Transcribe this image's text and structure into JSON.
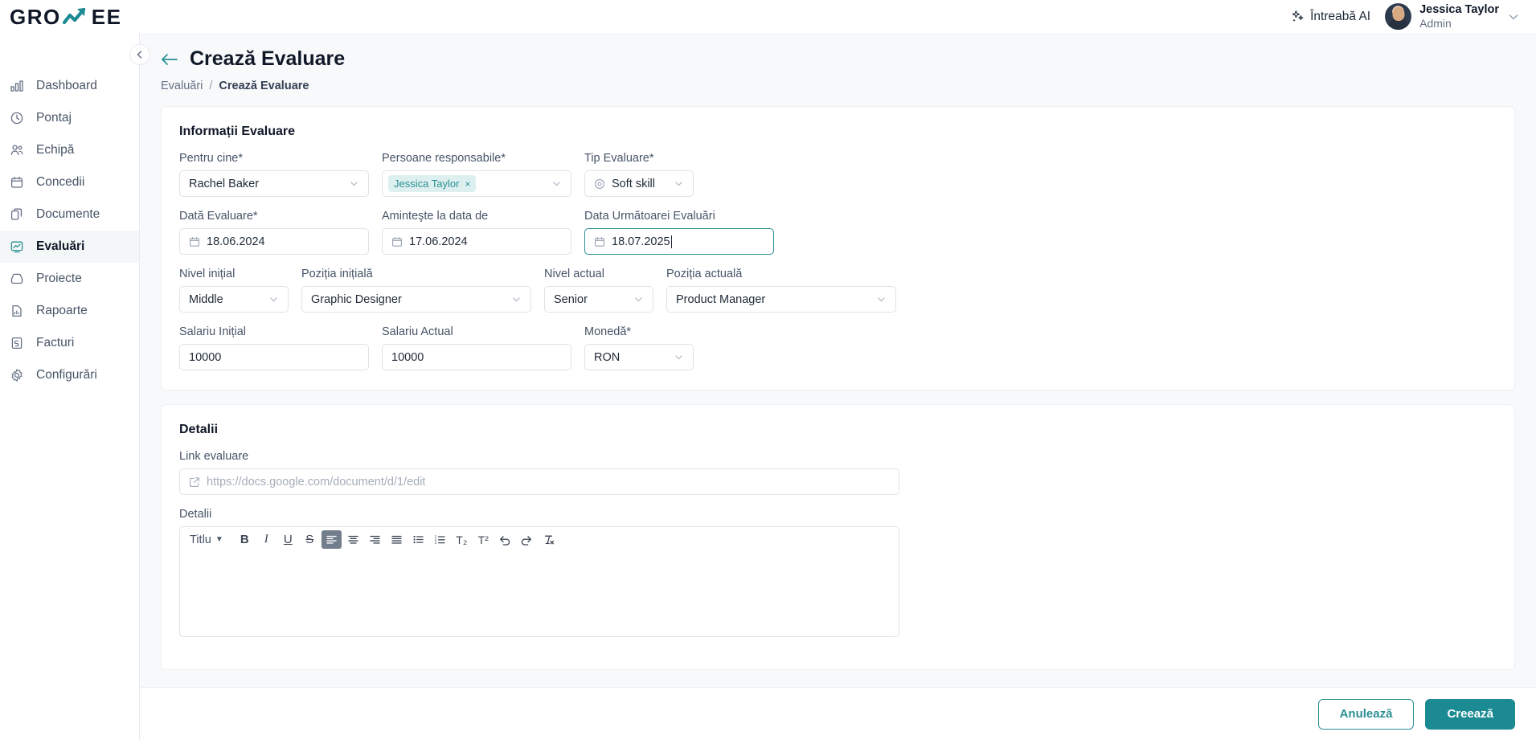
{
  "brand": {
    "name_part1": "GRO",
    "name_part2": "EE",
    "accent": "#1b8a92"
  },
  "topbar": {
    "ask_ai_label": "Întreabă AI",
    "user_name": "Jessica Taylor",
    "user_role": "Admin"
  },
  "sidebar": {
    "items": [
      {
        "label": "Dashboard",
        "icon": "bar-chart-icon",
        "active": false
      },
      {
        "label": "Pontaj",
        "icon": "clock-icon",
        "active": false
      },
      {
        "label": "Echipă",
        "icon": "users-icon",
        "active": false
      },
      {
        "label": "Concedii",
        "icon": "calendar-icon",
        "active": false
      },
      {
        "label": "Documente",
        "icon": "documents-icon",
        "active": false
      },
      {
        "label": "Evaluări",
        "icon": "evaluation-icon",
        "active": true
      },
      {
        "label": "Proiecte",
        "icon": "inbox-icon",
        "active": false
      },
      {
        "label": "Rapoarte",
        "icon": "report-icon",
        "active": false
      },
      {
        "label": "Facturi",
        "icon": "invoice-icon",
        "active": false
      },
      {
        "label": "Configurări",
        "icon": "gear-icon",
        "active": false
      }
    ]
  },
  "page": {
    "title": "Crează Evaluare",
    "breadcrumb": {
      "parent": "Evaluări",
      "separator": "/",
      "current": "Crează Evaluare"
    }
  },
  "info_section": {
    "title": "Informații Evaluare",
    "pentru_cine": {
      "label": "Pentru cine*",
      "value": "Rachel Baker"
    },
    "persoane_responsabile": {
      "label": "Persoane responsabile*",
      "tag": "Jessica Taylor",
      "tag_remove": "×"
    },
    "tip_evaluare": {
      "label": "Tip Evaluare*",
      "value": "Soft skill"
    },
    "data_evaluare": {
      "label": "Dată Evaluare*",
      "value": "18.06.2024"
    },
    "aminteste": {
      "label": "Aminteşte la data de",
      "value": "17.06.2024"
    },
    "data_urmatoare": {
      "label": "Data Următoarei Evaluări",
      "value": "18.07.2025"
    },
    "nivel_initial": {
      "label": "Nivel inițial",
      "value": "Middle"
    },
    "pozitia_initiala": {
      "label": "Poziția inițială",
      "value": "Graphic Designer"
    },
    "nivel_actual": {
      "label": "Nivel actual",
      "value": "Senior"
    },
    "pozitia_actuala": {
      "label": "Poziția actuală",
      "value": "Product Manager"
    },
    "salariu_initial": {
      "label": "Salariu Inițial",
      "value": "10000"
    },
    "salariu_actual": {
      "label": "Salariu Actual",
      "value": "10000"
    },
    "moneda": {
      "label": "Monedă*",
      "value": "RON"
    }
  },
  "details_section": {
    "title": "Detalii",
    "link_label": "Link evaluare",
    "link_placeholder": "https://docs.google.com/document/d/1/edit",
    "details_label": "Detalii",
    "toolbar": {
      "title_dropdown": "Titlu",
      "dropdown_caret": "▼",
      "bold": "B",
      "italic": "I",
      "underline": "U",
      "strike": "S",
      "align_left": "align-left",
      "align_center": "align-center",
      "align_right": "align-right",
      "align_justify": "align-justify",
      "bullet_list": "bullet-list",
      "numbered_list": "numbered-list",
      "subscript": "T₂",
      "superscript": "T²",
      "undo": "undo",
      "redo": "redo",
      "clear": "clear-format"
    },
    "editor_value": ""
  },
  "footer": {
    "cancel_label": "Anulează",
    "submit_label": "Creează"
  }
}
